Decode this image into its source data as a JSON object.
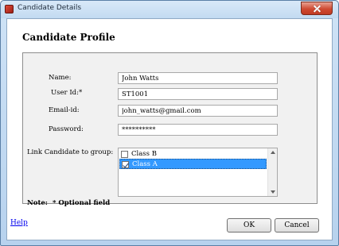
{
  "window": {
    "title": "Candidate Details"
  },
  "header": {
    "title": "Candidate Profile"
  },
  "form": {
    "name_label": "Name:",
    "name_value": "John Watts",
    "userid_label": "User Id:*",
    "userid_value": "ST1001",
    "email_label": "Email-id:",
    "email_value": "john_watts@gmail.com",
    "password_label": "Password:",
    "password_value": "**********",
    "group_label": "Link Candidate to group:",
    "groups": [
      {
        "label": "Class B",
        "checked": false,
        "selected": false
      },
      {
        "label": "Class A",
        "checked": true,
        "selected": true
      }
    ],
    "note_label": "Note:",
    "note_text": "* Optional field"
  },
  "footer": {
    "help_label": "Help",
    "ok_label": "OK",
    "cancel_label": "Cancel"
  },
  "icons": {
    "app": "app-icon",
    "close": "close-icon"
  }
}
